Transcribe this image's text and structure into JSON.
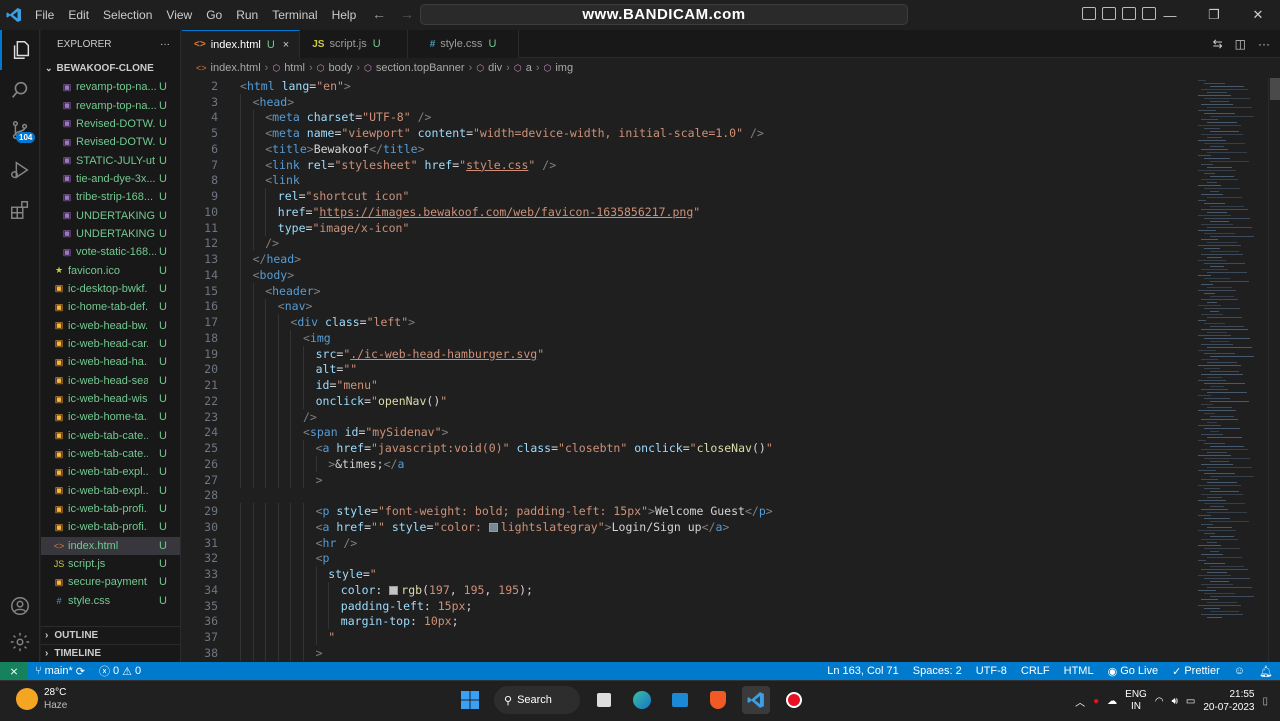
{
  "titlebar": {
    "menu": [
      "File",
      "Edit",
      "Selection",
      "View",
      "Go",
      "Run",
      "Terminal",
      "Help"
    ],
    "watermark": "www.BANDICAM.com"
  },
  "activity": {
    "scm_badge": "104"
  },
  "explorer": {
    "title": "EXPLORER",
    "more": "···",
    "folder": "BEWAKOOF-CLONE",
    "files": [
      {
        "name": "revamp-top-na...",
        "status": "U",
        "icon": "img",
        "nested": true
      },
      {
        "name": "revamp-top-na...",
        "status": "U",
        "icon": "img",
        "nested": true
      },
      {
        "name": "Revised-DOTW...",
        "status": "U",
        "icon": "img",
        "nested": true
      },
      {
        "name": "Revised-DOTW...",
        "status": "U",
        "icon": "img",
        "nested": true
      },
      {
        "name": "STATIC-JULY-ut...",
        "status": "U",
        "icon": "img",
        "nested": true
      },
      {
        "name": "tie-and-dye-3x...",
        "status": "U",
        "icon": "img",
        "nested": true
      },
      {
        "name": "tribe-strip-168...",
        "status": "U",
        "icon": "img",
        "nested": true
      },
      {
        "name": "UNDERTAKING...",
        "status": "U",
        "icon": "img",
        "nested": true
      },
      {
        "name": "UNDERTAKING...",
        "status": "U",
        "icon": "img",
        "nested": true
      },
      {
        "name": "vote-static-168...",
        "status": "U",
        "icon": "img",
        "nested": true
      },
      {
        "name": "favicon.ico",
        "status": "U",
        "icon": "star",
        "nested": false
      },
      {
        "name": "ic-desktop-bwkf...",
        "status": "U",
        "icon": "svg",
        "nested": false
      },
      {
        "name": "ic-home-tab-def...",
        "status": "U",
        "icon": "svg",
        "nested": false
      },
      {
        "name": "ic-web-head-bw...",
        "status": "U",
        "icon": "svg",
        "nested": false
      },
      {
        "name": "ic-web-head-car...",
        "status": "U",
        "icon": "svg",
        "nested": false
      },
      {
        "name": "ic-web-head-ha...",
        "status": "U",
        "icon": "svg",
        "nested": false
      },
      {
        "name": "ic-web-head-sea...",
        "status": "U",
        "icon": "svg",
        "nested": false
      },
      {
        "name": "ic-web-head-wis...",
        "status": "U",
        "icon": "svg",
        "nested": false
      },
      {
        "name": "ic-web-home-ta...",
        "status": "U",
        "icon": "svg",
        "nested": false
      },
      {
        "name": "ic-web-tab-cate...",
        "status": "U",
        "icon": "svg",
        "nested": false
      },
      {
        "name": "ic-web-tab-cate...",
        "status": "U",
        "icon": "svg",
        "nested": false
      },
      {
        "name": "ic-web-tab-expl...",
        "status": "U",
        "icon": "svg",
        "nested": false
      },
      {
        "name": "ic-web-tab-expl...",
        "status": "U",
        "icon": "svg",
        "nested": false
      },
      {
        "name": "ic-web-tab-profi...",
        "status": "U",
        "icon": "svg",
        "nested": false
      },
      {
        "name": "ic-web-tab-profi...",
        "status": "U",
        "icon": "svg",
        "nested": false
      },
      {
        "name": "index.html",
        "status": "U",
        "icon": "html",
        "nested": false,
        "selected": true
      },
      {
        "name": "script.js",
        "status": "U",
        "icon": "js",
        "nested": false
      },
      {
        "name": "secure-payment...",
        "status": "U",
        "icon": "svg",
        "nested": false
      },
      {
        "name": "style.css",
        "status": "U",
        "icon": "css",
        "nested": false
      }
    ],
    "outline": "OUTLINE",
    "timeline": "TIMELINE"
  },
  "tabs": [
    {
      "label": "index.html",
      "icon": "<>",
      "status": "U",
      "active": true,
      "close": "×"
    },
    {
      "label": "script.js",
      "icon": "JS",
      "status": "U",
      "active": false
    },
    {
      "label": "style.css",
      "icon": "#",
      "status": "U",
      "active": false
    }
  ],
  "breadcrumb": [
    "index.html",
    "html",
    "body",
    "section.topBanner",
    "div",
    "a",
    "img"
  ],
  "code_lines": [
    {
      "n": "2",
      "indent": 0,
      "html": "<span class='t'>&lt;</span><span class='tn'>html</span> <span class='an'>lang</span><span class='tx2'>=</span><span class='av'>\"en\"</span><span class='t'>&gt;</span>"
    },
    {
      "n": "3",
      "indent": 1,
      "html": "<span class='t'>&lt;</span><span class='tn'>head</span><span class='t'>&gt;</span>"
    },
    {
      "n": "4",
      "indent": 2,
      "html": "<span class='t'>&lt;</span><span class='tn'>meta</span> <span class='an'>charset</span><span class='tx2'>=</span><span class='av'>\"UTF-8\"</span> <span class='t'>/&gt;</span>"
    },
    {
      "n": "5",
      "indent": 2,
      "html": "<span class='t'>&lt;</span><span class='tn'>meta</span> <span class='an'>name</span><span class='tx2'>=</span><span class='av'>\"viewport\"</span> <span class='an'>content</span><span class='tx2'>=</span><span class='av'>\"width=device-width, initial-scale=1.0\"</span> <span class='t'>/&gt;</span>"
    },
    {
      "n": "6",
      "indent": 2,
      "html": "<span class='t'>&lt;</span><span class='tn'>title</span><span class='t'>&gt;</span><span class='tx2'>Bewakoof</span><span class='t'>&lt;/</span><span class='tn'>title</span><span class='t'>&gt;</span>"
    },
    {
      "n": "7",
      "indent": 2,
      "html": "<span class='t'>&lt;</span><span class='tn'>link</span> <span class='an'>rel</span><span class='tx2'>=</span><span class='av'>\"stylesheet\"</span> <span class='an'>href</span><span class='tx2'>=</span><span class='av'>\"<span class='u'>style.css</span>\"</span> <span class='t'>/&gt;</span>"
    },
    {
      "n": "8",
      "indent": 2,
      "html": "<span class='t'>&lt;</span><span class='tn'>link</span>"
    },
    {
      "n": "9",
      "indent": 3,
      "html": "<span class='an'>rel</span><span class='tx2'>=</span><span class='av'>\"shortcut icon\"</span>"
    },
    {
      "n": "10",
      "indent": 3,
      "html": "<span class='an'>href</span><span class='tx2'>=</span><span class='av'>\"<span class='u'>https://images.bewakoof.com/web/favicon-1635856217.png</span>\"</span>"
    },
    {
      "n": "11",
      "indent": 3,
      "html": "<span class='an'>type</span><span class='tx2'>=</span><span class='av'>\"image/x-icon\"</span>"
    },
    {
      "n": "12",
      "indent": 2,
      "html": "<span class='t'>/&gt;</span>"
    },
    {
      "n": "13",
      "indent": 1,
      "html": "<span class='t'>&lt;/</span><span class='tn'>head</span><span class='t'>&gt;</span>"
    },
    {
      "n": "14",
      "indent": 1,
      "html": "<span class='t'>&lt;</span><span class='tn'>body</span><span class='t'>&gt;</span>"
    },
    {
      "n": "15",
      "indent": 2,
      "html": "<span class='t'>&lt;</span><span class='tn'>header</span><span class='t'>&gt;</span>"
    },
    {
      "n": "16",
      "indent": 3,
      "html": "<span class='t'>&lt;</span><span class='tn'>nav</span><span class='t'>&gt;</span>"
    },
    {
      "n": "17",
      "indent": 4,
      "html": "<span class='t'>&lt;</span><span class='tn'>div</span> <span class='an'>class</span><span class='tx2'>=</span><span class='av'>\"left\"</span><span class='t'>&gt;</span>"
    },
    {
      "n": "18",
      "indent": 5,
      "html": "<span class='t'>&lt;</span><span class='tn'>img</span>"
    },
    {
      "n": "19",
      "indent": 6,
      "html": "<span class='an'>src</span><span class='tx2'>=</span><span class='av'>\"<span class='u'>./ic-web-head-hamburger.svg</span>\"</span>"
    },
    {
      "n": "20",
      "indent": 6,
      "html": "<span class='an'>alt</span><span class='tx2'>=</span><span class='av'>\"\"</span>"
    },
    {
      "n": "21",
      "indent": 6,
      "html": "<span class='an'>id</span><span class='tx2'>=</span><span class='av'>\"menu\"</span>"
    },
    {
      "n": "22",
      "indent": 6,
      "html": "<span class='an'>onclick</span><span class='tx2'>=</span><span class='av'>\"</span><span class='yl'>openNav</span><span class='tx2'>()</span><span class='av'>\"</span>"
    },
    {
      "n": "23",
      "indent": 5,
      "html": "<span class='t'>/&gt;</span>"
    },
    {
      "n": "24",
      "indent": 5,
      "html": "<span class='t'>&lt;</span><span class='tn'>span</span> <span class='an'>id</span><span class='tx2'>=</span><span class='av'>\"mySidenav\"</span><span class='t'>&gt;</span>"
    },
    {
      "n": "25",
      "indent": 6,
      "html": "<span class='t'>&lt;</span><span class='tn'>a</span> <span class='an'>href</span><span class='tx2'>=</span><span class='av'>\"javascript:void(0)\"</span> <span class='an'>class</span><span class='tx2'>=</span><span class='av'>\"closebtn\"</span> <span class='an'>onclick</span><span class='tx2'>=</span><span class='av'>\"</span><span class='yl'>closeNav</span><span class='tx2'>()</span><span class='av'>\"</span>"
    },
    {
      "n": "26",
      "indent": 7,
      "html": "<span class='t'>&gt;</span><span class='tx2'>&amp;times;</span><span class='t'>&lt;/</span><span class='tn'>a</span>"
    },
    {
      "n": "27",
      "indent": 6,
      "html": "<span class='t'>&gt;</span>"
    },
    {
      "n": "28",
      "indent": 0,
      "html": ""
    },
    {
      "n": "29",
      "indent": 6,
      "html": "<span class='t'>&lt;</span><span class='tn'>p</span> <span class='an'>style</span><span class='tx2'>=</span><span class='av'>\"font-weight: bold; padding-left: 15px\"</span><span class='t'>&gt;</span><span class='tx2'>Welcome Guest</span><span class='t'>&lt;/</span><span class='tn'>p</span><span class='t'>&gt;</span>"
    },
    {
      "n": "30",
      "indent": 6,
      "html": "<span class='t'>&lt;</span><span class='tn'>a</span> <span class='an'>href</span><span class='tx2'>=</span><span class='av'>\"\"</span> <span class='an'>style</span><span class='tx2'>=</span><span class='av'>\"color: <span class='sw' style='background:#778899'></span>lightslategray\"</span><span class='t'>&gt;</span><span class='tx2'>Login/Sign up</span><span class='t'>&lt;/</span><span class='tn'>a</span><span class='t'>&gt;</span>"
    },
    {
      "n": "31",
      "indent": 6,
      "html": "<span class='t'>&lt;</span><span class='tn'>hr</span> <span class='t'>/&gt;</span>"
    },
    {
      "n": "32",
      "indent": 6,
      "html": "<span class='t'>&lt;</span><span class='tn'>p</span>"
    },
    {
      "n": "33",
      "indent": 7,
      "html": "<span class='an'>style</span><span class='tx2'>=</span><span class='av'>\"</span>"
    },
    {
      "n": "34",
      "indent": 8,
      "html": "<span class='cs'>color</span><span class='tx2'>: </span><span class='sw' style='background:#c5c3c3'></span><span class='yl'>rgb</span><span class='tx2'>(</span><span class='av'>197</span><span class='tx2'>, </span><span class='av'>195</span><span class='tx2'>, </span><span class='av'>195</span><span class='tx2'>);</span>"
    },
    {
      "n": "35",
      "indent": 8,
      "html": "<span class='cs'>padding-left</span><span class='tx2'>: </span><span class='av'>15px</span><span class='tx2'>;</span>"
    },
    {
      "n": "36",
      "indent": 8,
      "html": "<span class='cs'>margin-top</span><span class='tx2'>: </span><span class='av'>10px</span><span class='tx2'>;</span>"
    },
    {
      "n": "37",
      "indent": 7,
      "html": "<span class='av'>\"</span>"
    },
    {
      "n": "38",
      "indent": 6,
      "html": "<span class='t'>&gt;</span>"
    }
  ],
  "statusbar": {
    "branch": "main*",
    "errors": "0",
    "warnings": "0",
    "position": "Ln 163, Col 71",
    "spaces": "Spaces: 2",
    "encoding": "UTF-8",
    "eol": "CRLF",
    "language": "HTML",
    "golive": "Go Live",
    "prettier": "Prettier"
  },
  "taskbar": {
    "temp": "28°C",
    "weather": "Haze",
    "search": "Search",
    "lang1": "ENG",
    "lang2": "IN",
    "time": "21:55",
    "date": "20-07-2023"
  }
}
